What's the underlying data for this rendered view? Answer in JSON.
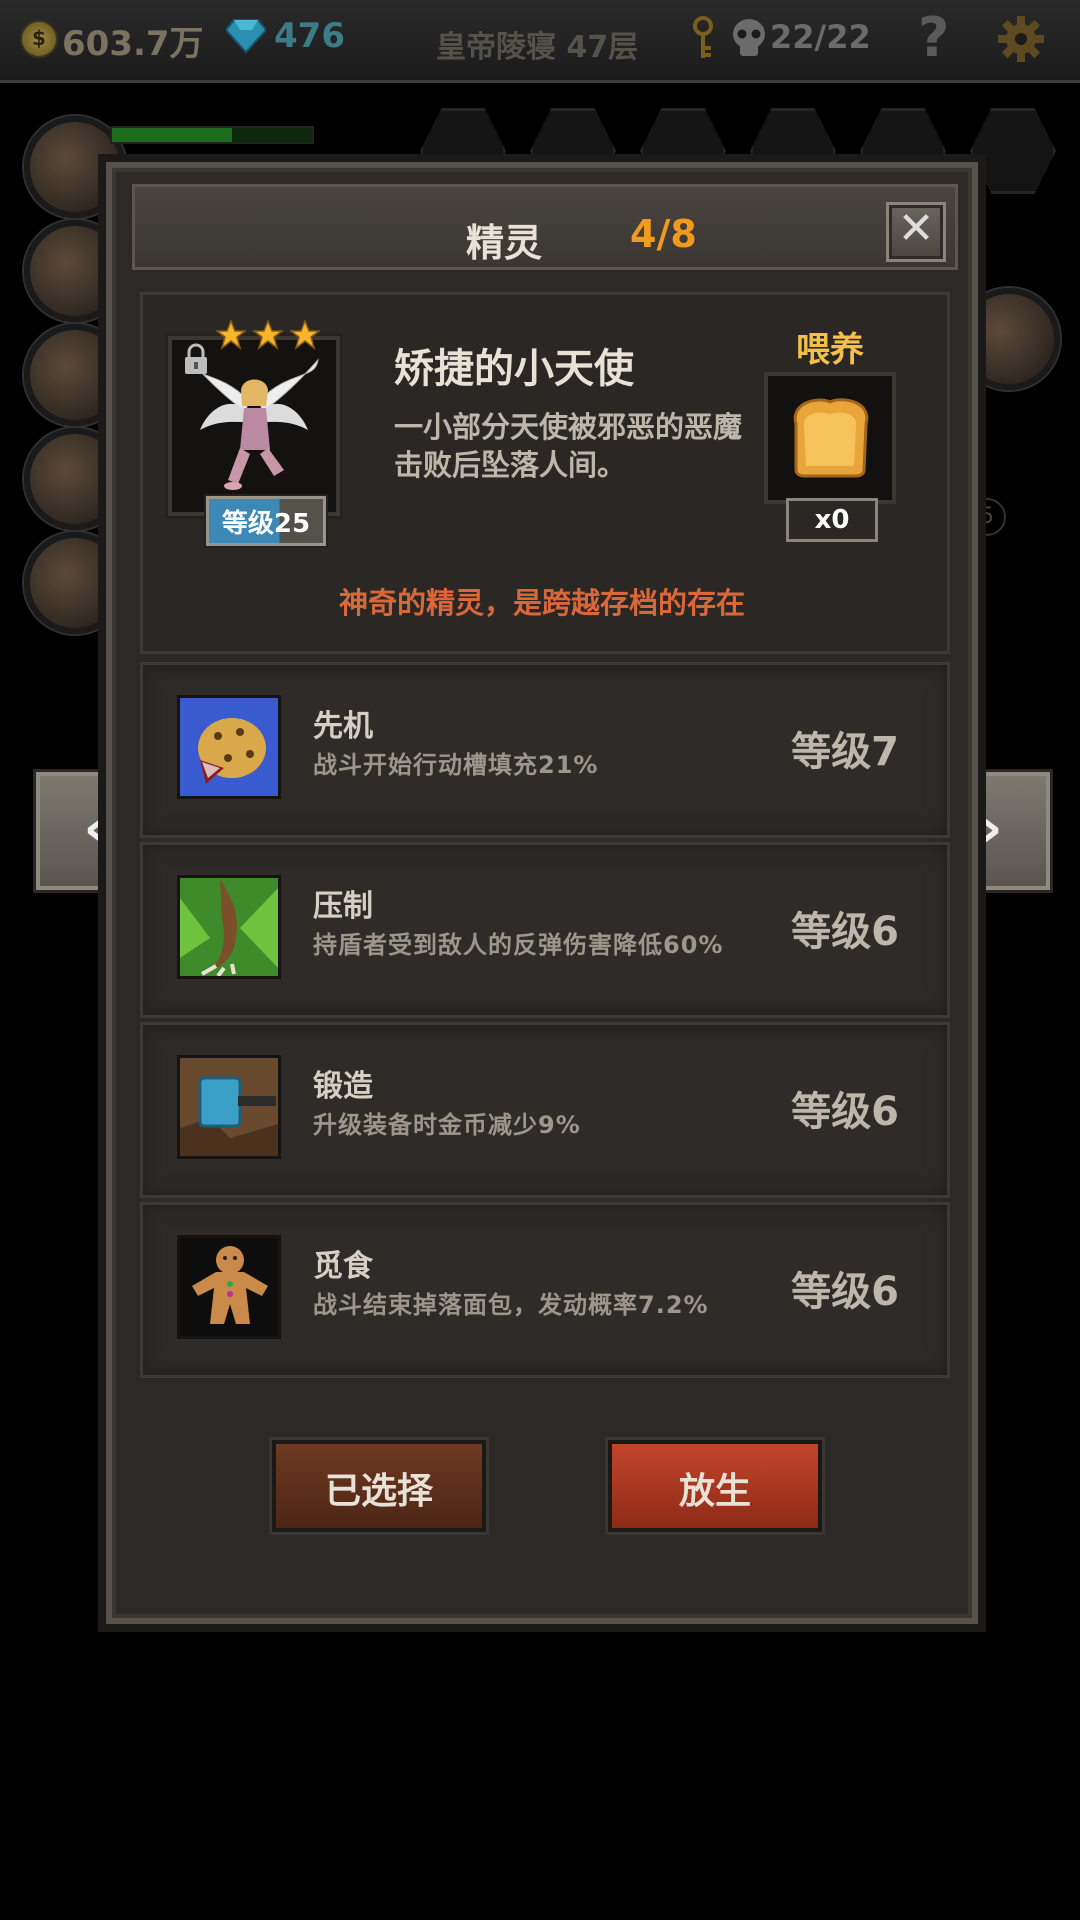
{
  "topbar": {
    "gold": "603.7万",
    "gems": "476",
    "location": "皇帝陵寝 47层",
    "skulls": "22/22",
    "help": "?"
  },
  "background": {
    "partial_number": "5"
  },
  "dialog": {
    "title": "精灵",
    "count": "4/8",
    "close": "✕",
    "sprite": {
      "name": "矫捷的小天使",
      "description": "一小部分天使被邪恶的恶魔击败后坠落人间。",
      "stars": 3,
      "level": "等级25",
      "level_progress": 0.62,
      "locked": true
    },
    "feed": {
      "label": "喂养",
      "count": "x0"
    },
    "tagline": "神奇的精灵，是跨越存档的存在",
    "skills": [
      {
        "icon": "leopard-icon",
        "name": "先机",
        "desc": "战斗开始行动槽填充21%",
        "level": "等级7"
      },
      {
        "icon": "claw-icon",
        "name": "压制",
        "desc": "持盾者受到敌人的反弹伤害降低60%",
        "level": "等级6"
      },
      {
        "icon": "hammer-icon",
        "name": "锻造",
        "desc": "升级装备时金币减少9%",
        "level": "等级6"
      },
      {
        "icon": "gingerbread-icon",
        "name": "觅食",
        "desc": "战斗结束掉落面包，发动概率7.2%",
        "level": "等级6"
      }
    ],
    "buttons": {
      "selected": "已选择",
      "release": "放生"
    }
  },
  "nav": {
    "prev": "‹",
    "next": "›"
  },
  "colors": {
    "count": "#f09a1e",
    "feed_label": "#f2c14a",
    "tagline": "#d9673a",
    "release_button": "#c2452b",
    "selected_button": "#6e3a22"
  }
}
